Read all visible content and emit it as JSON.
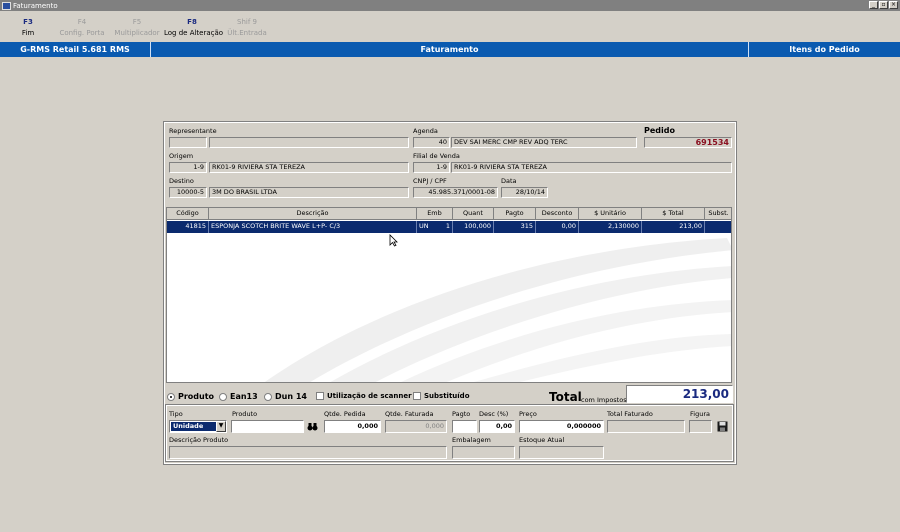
{
  "window": {
    "title": "Faturamento"
  },
  "fkeys": [
    {
      "key": "F3",
      "label": "Fim",
      "enabled": true
    },
    {
      "key": "F4",
      "label": "Config. Porta",
      "enabled": false
    },
    {
      "key": "F5",
      "label": "Multiplicador",
      "enabled": false
    },
    {
      "key": "F8",
      "label": "Log de Alteração",
      "enabled": true
    },
    {
      "key": "Shif 9",
      "label": "Ült.Entrada",
      "enabled": false
    }
  ],
  "header": {
    "system": "G-RMS Retail 5.681 RMS",
    "title": "Faturamento",
    "right": "Itens do Pedido"
  },
  "form": {
    "representante": {
      "label": "Representante",
      "code": "",
      "name": ""
    },
    "agenda": {
      "label": "Agenda",
      "code": "40",
      "desc": "DEV SAI MERC CMP REV ADQ TERC"
    },
    "pedido": {
      "label": "Pedido",
      "value": "691534"
    },
    "origem": {
      "label": "Origem",
      "code": "1-9",
      "name": "RK01-9 RIVIERA STA TEREZA"
    },
    "filial": {
      "label": "Filial de Venda",
      "code": "1-9",
      "name": "RK01-9 RIVIERA STA TEREZA"
    },
    "destino": {
      "label": "Destino",
      "code": "10000-5",
      "name": "3M DO BRASIL LTDA"
    },
    "cnpj": {
      "label": "CNPJ / CPF",
      "value": "45.985.371/0001-08"
    },
    "data": {
      "label": "Data",
      "value": "28/10/14"
    }
  },
  "table": {
    "columns": [
      "Código",
      "Descrição",
      "Emb",
      "Quant",
      "Pagto",
      "Desconto",
      "$ Unitário",
      "$ Total",
      "Subst."
    ],
    "rows": [
      {
        "codigo": "41815",
        "descricao": "ESPONJA SCOTCH BRITE WAVE L+P- C/3",
        "emb": "UN",
        "emb_qty": "1",
        "quant": "100,000",
        "pagto": "315",
        "desconto": "0,00",
        "unitario": "2,130000",
        "total": "213,00",
        "subst": ""
      }
    ]
  },
  "options": {
    "produto": "Produto",
    "ean13": "Ean13",
    "dun14": "Dun 14",
    "scanner": "Utilização de scanner",
    "substituido": "Substituído",
    "selected": "produto"
  },
  "totals": {
    "label": "Total",
    "sub": "com Impostos",
    "value": "213,00"
  },
  "entry": {
    "tipo_label": "Tipo",
    "tipo_value": "Unidade",
    "produto_label": "Produto",
    "produto_value": "",
    "qtde_pedida_label": "Qtde. Pedida",
    "qtde_pedida_value": "0,000",
    "qtde_faturada_label": "Qtde. Faturada",
    "qtde_faturada_value": "0,000",
    "pagto_label": "Pagto",
    "pagto_value": "",
    "desc_label": "Desc (%)",
    "desc_value": "0,00",
    "preco_label": "Preço",
    "preco_value": "0,000000",
    "total_faturado_label": "Total Faturado",
    "total_faturado_value": "",
    "figura_label": "Figura",
    "figura_value": "",
    "descricao_label": "Descrição Produto",
    "descricao_value": "",
    "embalagem_label": "Embalagem",
    "embalagem_value": "",
    "estoque_label": "Estoque Atual",
    "estoque_value": ""
  },
  "colors": {
    "accent": "#0a5ab0",
    "selection": "#0b2a6e",
    "pedido": "#8a1020"
  }
}
